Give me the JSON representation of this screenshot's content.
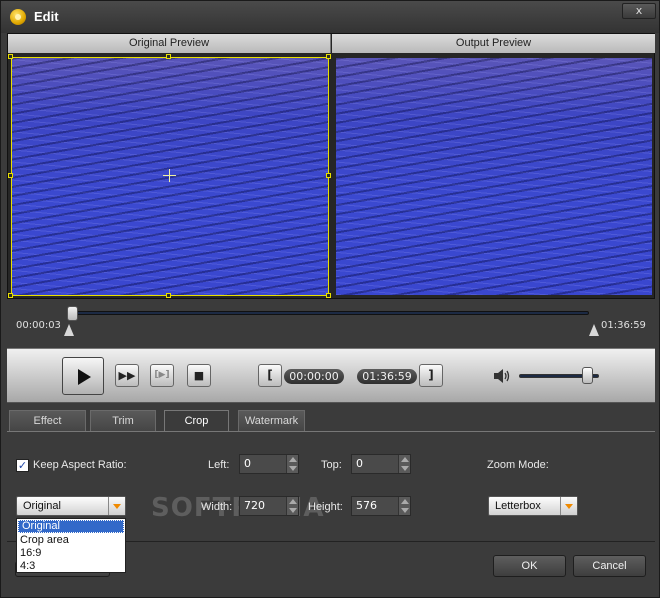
{
  "window": {
    "title": "Edit",
    "close_label": "x"
  },
  "preview": {
    "original_label": "Original Preview",
    "output_label": "Output Preview"
  },
  "timeline": {
    "start_time": "00:00:03",
    "end_time": "01:36:59"
  },
  "controls": {
    "next_frame_label": "▶▶",
    "clip_label": "[▶]",
    "stop_label": "■",
    "set_start_label": "[",
    "start_time": "00:00:00",
    "end_time": "01:36:59",
    "set_end_label": "]",
    "volume_fraction": 0.85
  },
  "tabs": [
    {
      "label": "Effect"
    },
    {
      "label": "Trim"
    },
    {
      "label": "Crop"
    },
    {
      "label": "Watermark"
    }
  ],
  "active_tab": "Crop",
  "crop": {
    "keep_aspect_label": "Keep Aspect Ratio:",
    "keep_aspect_checked": true,
    "left_label": "Left:",
    "left_value": "0",
    "top_label": "Top:",
    "top_value": "0",
    "width_label": "Width:",
    "width_value": "720",
    "height_label": "Height:",
    "height_value": "576",
    "zoom_mode_label": "Zoom Mode:",
    "zoom_mode_value": "Letterbox",
    "aspect_value": "Original",
    "aspect_options": [
      "Original",
      "Crop area",
      "16:9",
      "4:3"
    ]
  },
  "watermark_text": "SOFTPEDIA",
  "buttons": {
    "ok": "OK",
    "cancel": "Cancel"
  },
  "colors": {
    "crop_frame": "#e8e000",
    "accent_orange": "#f08a00",
    "selection_blue": "#3269c9"
  }
}
